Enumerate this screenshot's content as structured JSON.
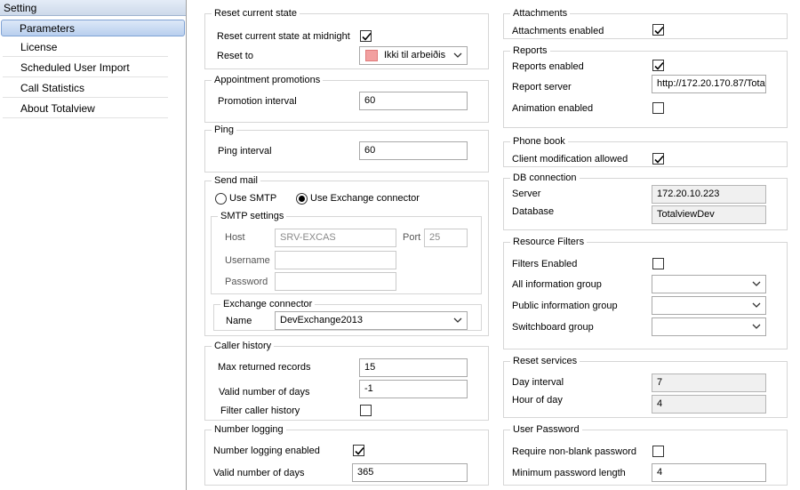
{
  "sidebar": {
    "header": "Setting",
    "items": [
      {
        "label": "Parameters",
        "active": true
      },
      {
        "label": "License"
      },
      {
        "label": "Scheduled User Import"
      },
      {
        "label": "Call Statistics"
      },
      {
        "label": "About Totalview"
      }
    ]
  },
  "reset_state": {
    "title": "Reset current state",
    "midnight_label": "Reset current state at midnight",
    "midnight_checked": true,
    "reset_to_label": "Reset to",
    "reset_to_value": "Ikki til arbeiðis",
    "reset_to_color": "#f2a0a0"
  },
  "appointment": {
    "title": "Appointment promotions",
    "interval_label": "Promotion interval",
    "interval_value": "60"
  },
  "ping": {
    "title": "Ping",
    "interval_label": "Ping interval",
    "interval_value": "60"
  },
  "send_mail": {
    "title": "Send mail",
    "use_smtp_label": "Use SMTP",
    "use_exchange_label": "Use Exchange connector",
    "selected": "exchange",
    "smtp": {
      "title": "SMTP settings",
      "host_label": "Host",
      "host_value": "SRV-EXCAS",
      "port_label": "Port",
      "port_value": "25",
      "username_label": "Username",
      "username_value": "",
      "password_label": "Password",
      "password_value": ""
    },
    "exchange": {
      "title": "Exchange connector",
      "name_label": "Name",
      "name_value": "DevExchange2013"
    }
  },
  "caller_history": {
    "title": "Caller history",
    "max_records_label": "Max returned records",
    "max_records_value": "15",
    "valid_days_label": "Valid number of days",
    "valid_days_value": "-1",
    "filter_label": "Filter caller history",
    "filter_checked": false
  },
  "number_logging": {
    "title": "Number logging",
    "enabled_label": "Number logging enabled",
    "enabled_checked": true,
    "valid_days_label": "Valid number of days",
    "valid_days_value": "365"
  },
  "attachments": {
    "title": "Attachments",
    "enabled_label": "Attachments enabled",
    "enabled_checked": true
  },
  "reports": {
    "title": "Reports",
    "enabled_label": "Reports enabled",
    "enabled_checked": true,
    "server_label": "Report server",
    "server_value": "http://172.20.170.87/Tota",
    "animation_label": "Animation enabled",
    "animation_checked": false
  },
  "phone_book": {
    "title": "Phone book",
    "client_mod_label": "Client modification allowed",
    "client_mod_checked": true
  },
  "db_connection": {
    "title": "DB connection",
    "server_label": "Server",
    "server_value": "172.20.10.223",
    "database_label": "Database",
    "database_value": "TotalviewDev"
  },
  "resource_filters": {
    "title": "Resource Filters",
    "enabled_label": "Filters Enabled",
    "enabled_checked": false,
    "all_info_label": "All information group",
    "all_info_value": "",
    "public_info_label": "Public information group",
    "public_info_value": "",
    "switchboard_label": "Switchboard group",
    "switchboard_value": ""
  },
  "reset_services": {
    "title": "Reset services",
    "day_interval_label": "Day interval",
    "day_interval_value": "7",
    "hour_label": "Hour of day",
    "hour_value": "4"
  },
  "user_password": {
    "title": "User Password",
    "require_label": "Require non-blank password",
    "require_checked": false,
    "min_length_label": "Minimum password length",
    "min_length_value": "4"
  }
}
